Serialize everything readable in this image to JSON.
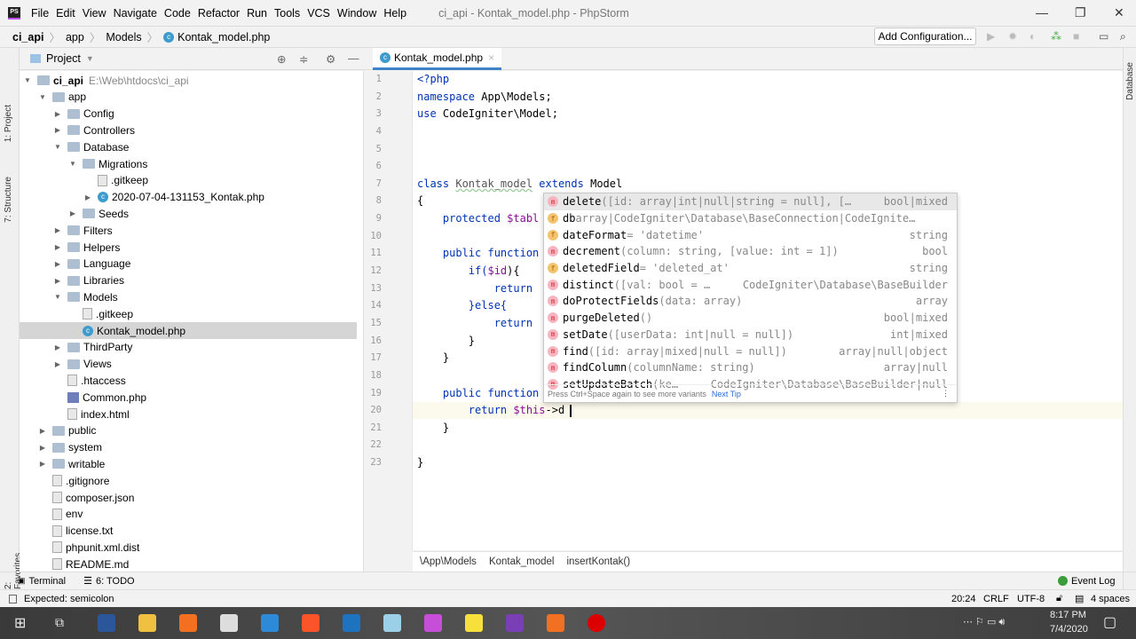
{
  "window": {
    "title": "ci_api - Kontak_model.php - PhpStorm",
    "logo": "PS",
    "minimize": "—",
    "maximize": "❐",
    "close": "✕"
  },
  "menu": [
    "File",
    "Edit",
    "View",
    "Navigate",
    "Code",
    "Refactor",
    "Run",
    "Tools",
    "VCS",
    "Window",
    "Help"
  ],
  "breadcrumb": [
    "ci_api",
    "app",
    "Models",
    "Kontak_model.php"
  ],
  "toolbar": {
    "add_config": "Add Configuration..."
  },
  "left_tabs": [
    "1: Project",
    "7: Structure",
    "2: Favorites"
  ],
  "right_tabs": [
    "Database"
  ],
  "project": {
    "title": "Project",
    "items": [
      {
        "label": "ci_api",
        "hint": "E:\\Web\\htdocs\\ci_api",
        "level": 0,
        "type": "folder",
        "state": "open"
      },
      {
        "label": "app",
        "level": 1,
        "type": "folder",
        "state": "open"
      },
      {
        "label": "Config",
        "level": 2,
        "type": "folder",
        "state": "closed"
      },
      {
        "label": "Controllers",
        "level": 2,
        "type": "folder",
        "state": "closed"
      },
      {
        "label": "Database",
        "level": 2,
        "type": "folder",
        "state": "open"
      },
      {
        "label": "Migrations",
        "level": 3,
        "type": "folder",
        "state": "open"
      },
      {
        "label": ".gitkeep",
        "level": 4,
        "type": "file"
      },
      {
        "label": "2020-07-04-131153_Kontak.php",
        "level": 4,
        "type": "class",
        "state": "closed"
      },
      {
        "label": "Seeds",
        "level": 3,
        "type": "folder",
        "state": "closed"
      },
      {
        "label": "Filters",
        "level": 2,
        "type": "folder",
        "state": "closed"
      },
      {
        "label": "Helpers",
        "level": 2,
        "type": "folder",
        "state": "closed"
      },
      {
        "label": "Language",
        "level": 2,
        "type": "folder",
        "state": "closed"
      },
      {
        "label": "Libraries",
        "level": 2,
        "type": "folder",
        "state": "closed"
      },
      {
        "label": "Models",
        "level": 2,
        "type": "folder",
        "state": "open"
      },
      {
        "label": ".gitkeep",
        "level": 3,
        "type": "file"
      },
      {
        "label": "Kontak_model.php",
        "level": 3,
        "type": "class",
        "selected": true
      },
      {
        "label": "ThirdParty",
        "level": 2,
        "type": "folder",
        "state": "closed"
      },
      {
        "label": "Views",
        "level": 2,
        "type": "folder",
        "state": "closed"
      },
      {
        "label": ".htaccess",
        "level": 2,
        "type": "file"
      },
      {
        "label": "Common.php",
        "level": 2,
        "type": "php"
      },
      {
        "label": "index.html",
        "level": 2,
        "type": "file"
      },
      {
        "label": "public",
        "level": 1,
        "type": "folder",
        "state": "closed"
      },
      {
        "label": "system",
        "level": 1,
        "type": "folder",
        "state": "closed"
      },
      {
        "label": "writable",
        "level": 1,
        "type": "folder",
        "state": "closed"
      },
      {
        "label": ".gitignore",
        "level": 1,
        "type": "file"
      },
      {
        "label": "composer.json",
        "level": 1,
        "type": "file"
      },
      {
        "label": "env",
        "level": 1,
        "type": "file"
      },
      {
        "label": "license.txt",
        "level": 1,
        "type": "file"
      },
      {
        "label": "phpunit.xml.dist",
        "level": 1,
        "type": "file"
      },
      {
        "label": "README.md",
        "level": 1,
        "type": "file"
      }
    ]
  },
  "editor": {
    "tab": "Kontak_model.php",
    "lines": [
      [
        [
          "<?php",
          "tag"
        ]
      ],
      [
        [
          "namespace ",
          "kw"
        ],
        [
          "App\\Models;",
          "cls"
        ]
      ],
      [
        [
          "use ",
          "kw"
        ],
        [
          "CodeIgniter\\Model;",
          "cls"
        ]
      ],
      [],
      [],
      [],
      [
        [
          "class ",
          "kw"
        ],
        [
          "Kontak_model",
          "und"
        ],
        [
          " extends ",
          "kw"
        ],
        [
          "Model",
          "cls"
        ]
      ],
      [
        [
          "{",
          "cls"
        ]
      ],
      [
        [
          "    protected ",
          "kw"
        ],
        [
          "$tabl",
          "var"
        ]
      ],
      [],
      [
        [
          "    public ",
          "kw"
        ],
        [
          "function",
          "kw"
        ]
      ],
      [
        [
          "        if(",
          "kw"
        ],
        [
          "$id",
          "var"
        ],
        [
          "){",
          "cls"
        ]
      ],
      [
        [
          "            return",
          "kw"
        ]
      ],
      [
        [
          "        }else{",
          "kw"
        ]
      ],
      [
        [
          "            return",
          "kw"
        ]
      ],
      [
        [
          "        }",
          "cls"
        ]
      ],
      [
        [
          "    }",
          "cls"
        ]
      ],
      [],
      [
        [
          "    public ",
          "kw"
        ],
        [
          "function",
          "kw"
        ]
      ],
      [
        [
          "        return ",
          "kw"
        ],
        [
          "$this",
          "var"
        ],
        [
          "->d",
          "cls"
        ]
      ],
      [
        [
          "    }",
          "cls"
        ]
      ],
      [],
      [
        [
          "}",
          "cls"
        ]
      ]
    ],
    "status_path": [
      "\\App\\Models",
      "Kontak_model",
      "insertKontak()"
    ]
  },
  "completion": {
    "items": [
      {
        "kind": "m",
        "name": "delete",
        "sig": "([id: array|int|null|string = null], […",
        "type": "bool|mixed",
        "selected": true
      },
      {
        "kind": "f",
        "name": "db",
        "sig": "   array|CodeIgniter\\Database\\BaseConnection|CodeIgnite…",
        "type": ""
      },
      {
        "kind": "f",
        "name": "dateFormat",
        "sig": " = 'datetime'",
        "type": "string"
      },
      {
        "kind": "m",
        "name": "decrement",
        "sig": "(column: string, [value: int = 1])",
        "type": "bool"
      },
      {
        "kind": "f",
        "name": "deletedField",
        "sig": " = 'deleted_at'",
        "type": "string"
      },
      {
        "kind": "m",
        "name": "distinct",
        "sig": "([val: bool = …",
        "type": "CodeIgniter\\Database\\BaseBuilder"
      },
      {
        "kind": "m",
        "name": "doProtectFields",
        "sig": "(data: array)",
        "type": "array"
      },
      {
        "kind": "m",
        "name": "purgeDeleted",
        "sig": "()",
        "type": "bool|mixed"
      },
      {
        "kind": "m",
        "name": "setDate",
        "sig": "([userData: int|null = null])",
        "type": "int|mixed"
      },
      {
        "kind": "m",
        "name": "find",
        "sig": "([id: array|mixed|null = null])",
        "type": "array|null|object"
      },
      {
        "kind": "m",
        "name": "findColumn",
        "sig": "(columnName: string)",
        "type": "array|null"
      },
      {
        "kind": "m",
        "name": "setUpdateBatch",
        "sig": "(ke…",
        "type": "CodeIgniter\\Database\\BaseBuilder|null"
      }
    ],
    "footer": "Press Ctrl+Space again to see more variants",
    "next_tip": "Next Tip"
  },
  "bottom_tools": {
    "terminal": "Terminal",
    "todo": "6: TODO",
    "event_log": "Event Log"
  },
  "status": {
    "message": "Expected: semicolon",
    "position": "20:24",
    "line_sep": "CRLF",
    "encoding": "UTF-8",
    "indent": "4 spaces"
  },
  "taskbar": {
    "time": "8:17 PM",
    "date": "7/4/2020",
    "apps": [
      {
        "name": "word",
        "color": "#2b579a"
      },
      {
        "name": "file-explorer",
        "color": "#f0c040"
      },
      {
        "name": "xampp",
        "color": "#f37021"
      },
      {
        "name": "calendar",
        "color": "#ddd"
      },
      {
        "name": "vscode",
        "color": "#2c8ad8"
      },
      {
        "name": "brave",
        "color": "#fb542b"
      },
      {
        "name": "app-blue",
        "color": "#1e73be"
      },
      {
        "name": "app-notes",
        "color": "#9cd0e8"
      },
      {
        "name": "chrome-like",
        "color": "#c64ed8"
      },
      {
        "name": "sticky-notes",
        "color": "#f7e03c"
      },
      {
        "name": "phpstorm",
        "color": "#7b3fb5"
      },
      {
        "name": "app-orange",
        "color": "#f27022"
      },
      {
        "name": "recorder",
        "color": "#d00"
      }
    ]
  }
}
